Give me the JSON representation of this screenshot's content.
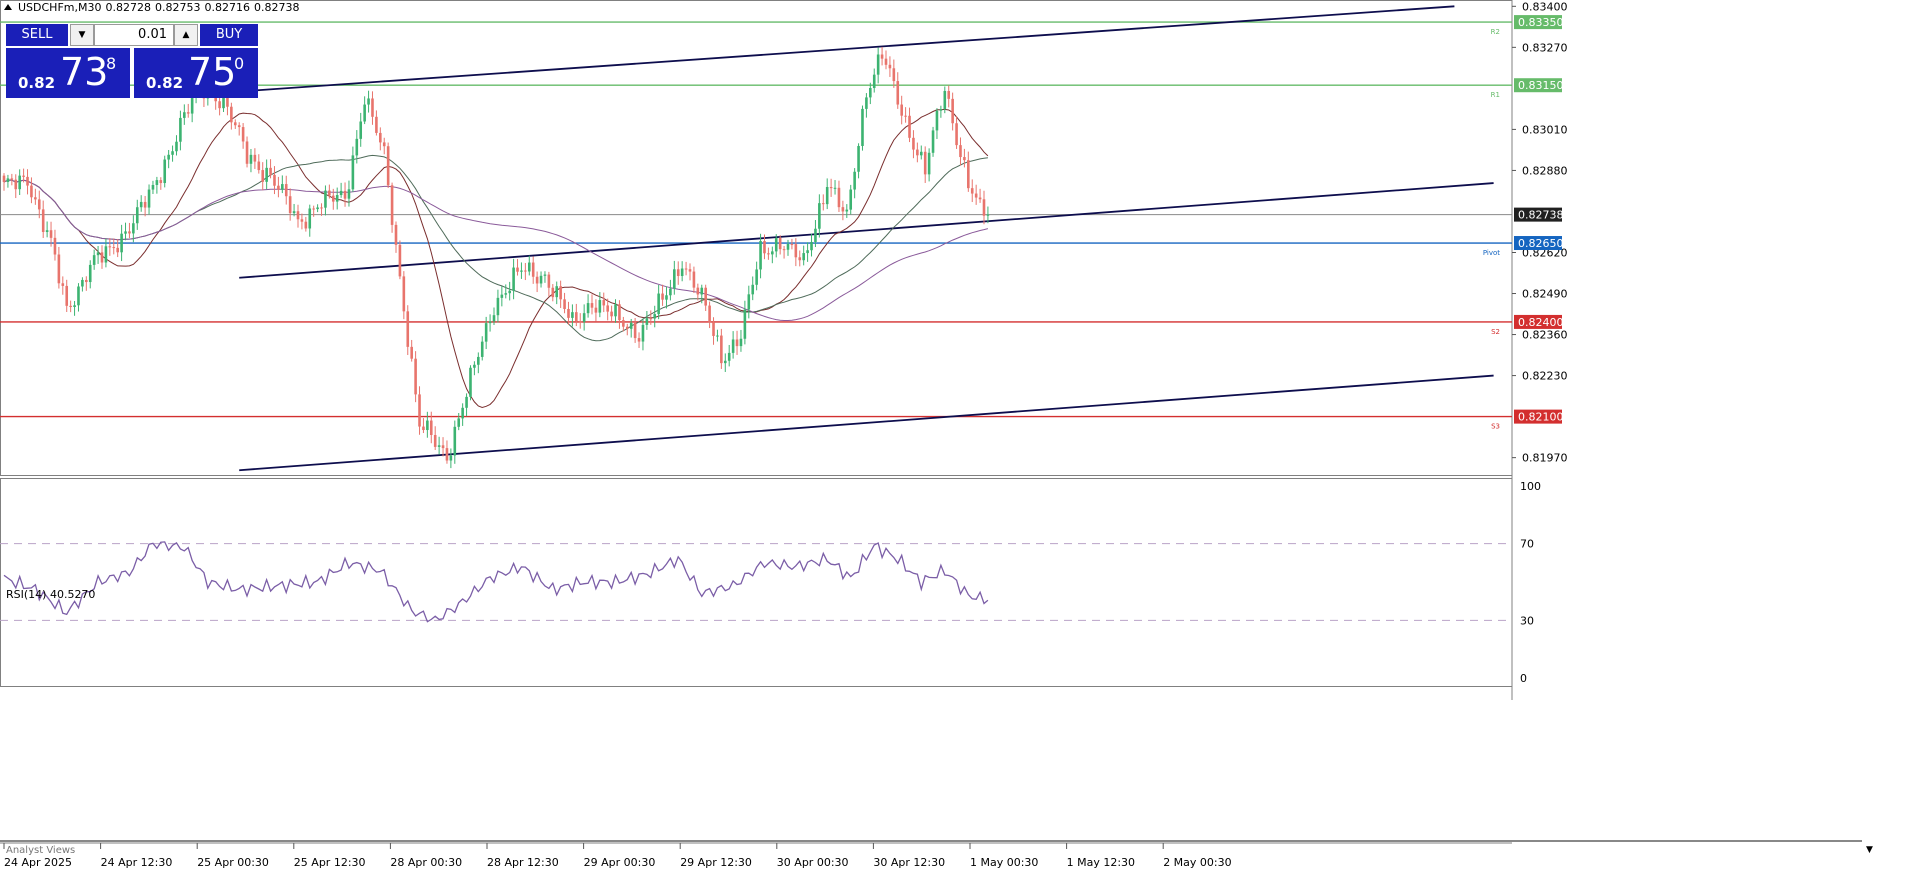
{
  "symbol_header": {
    "symbol": "USDCHFm,M30",
    "open": "0.82728",
    "high": "0.82753",
    "low": "0.82716",
    "close": "0.82738"
  },
  "trade_panel": {
    "sell_label": "SELL",
    "buy_label": "BUY",
    "lot": "0.01",
    "sell_small": "0.82",
    "sell_big": "73",
    "sell_sup": "8",
    "buy_small": "0.82",
    "buy_big": "75",
    "buy_sup": "0"
  },
  "colors": {
    "bull": "#3cb371",
    "bear": "#e8746c",
    "support": "#d32f2f",
    "resistance": "#66bb6a",
    "pivot": "#1565c0",
    "channel": "#0d0d4d",
    "rsi": "#7b5ea7"
  },
  "price_axis": {
    "ticks": [
      "0.83400",
      "0.83270",
      "0.83010",
      "0.82880",
      "0.82620",
      "0.82490",
      "0.82360",
      "0.82230",
      "0.81970"
    ],
    "ylim": [
      0.81915,
      0.8342
    ]
  },
  "levels": [
    {
      "name": "R2",
      "price": 0.8335,
      "label": "0.83350",
      "color": "#66bb6a"
    },
    {
      "name": "R1",
      "price": 0.8315,
      "label": "0.83150",
      "color": "#66bb6a"
    },
    {
      "name": "Pivot",
      "price": 0.8265,
      "label": "0.82650",
      "color": "#1565c0"
    },
    {
      "name": "S2",
      "price": 0.824,
      "label": "0.82400",
      "color": "#d32f2f"
    },
    {
      "name": "S3",
      "price": 0.821,
      "label": "0.82100",
      "color": "#d32f2f"
    }
  ],
  "current_price": {
    "price": 0.82738,
    "label": "0.82738"
  },
  "time_axis": {
    "labels": [
      "24 Apr 2025",
      "24 Apr 12:30",
      "25 Apr 00:30",
      "25 Apr 12:30",
      "28 Apr 00:30",
      "28 Apr 12:30",
      "29 Apr 00:30",
      "29 Apr 12:30",
      "30 Apr 00:30",
      "30 Apr 12:30",
      "1 May 00:30",
      "1 May 12:30",
      "2 May 00:30"
    ]
  },
  "rsi": {
    "title": "RSI(14) 40.5270",
    "ticks": [
      "100",
      "70",
      "30",
      "0"
    ]
  },
  "analyst_label": "Analyst Views",
  "chart_data": {
    "type": "candlestick",
    "timeframe": "M30",
    "symbol": "USDCHFm",
    "close_anchors": [
      [
        0,
        0.8282
      ],
      [
        6,
        0.8286
      ],
      [
        12,
        0.8264
      ],
      [
        16,
        0.8244
      ],
      [
        22,
        0.8258
      ],
      [
        27,
        0.8262
      ],
      [
        32,
        0.8271
      ],
      [
        38,
        0.8281
      ],
      [
        45,
        0.8303
      ],
      [
        50,
        0.8314
      ],
      [
        56,
        0.8311
      ],
      [
        62,
        0.8292
      ],
      [
        68,
        0.8287
      ],
      [
        75,
        0.8271
      ],
      [
        80,
        0.8278
      ],
      [
        87,
        0.8279
      ],
      [
        92,
        0.8312
      ],
      [
        97,
        0.8292
      ],
      [
        103,
        0.8236
      ],
      [
        106,
        0.8207
      ],
      [
        113,
        0.8198
      ],
      [
        119,
        0.8221
      ],
      [
        125,
        0.8246
      ],
      [
        132,
        0.8256
      ],
      [
        138,
        0.8255
      ],
      [
        145,
        0.8239
      ],
      [
        150,
        0.8247
      ],
      [
        156,
        0.8241
      ],
      [
        162,
        0.8237
      ],
      [
        168,
        0.8246
      ],
      [
        173,
        0.826
      ],
      [
        178,
        0.8247
      ],
      [
        183,
        0.8229
      ],
      [
        188,
        0.8236
      ],
      [
        193,
        0.8262
      ],
      [
        198,
        0.8266
      ],
      [
        204,
        0.8258
      ],
      [
        210,
        0.8285
      ],
      [
        215,
        0.8272
      ],
      [
        220,
        0.8314
      ],
      [
        224,
        0.8325
      ],
      [
        229,
        0.8306
      ],
      [
        235,
        0.8289
      ],
      [
        240,
        0.8313
      ],
      [
        246,
        0.8285
      ],
      [
        249,
        0.8275
      ],
      [
        251,
        0.8274
      ]
    ],
    "moving_averages": [
      {
        "name": "MA fast",
        "color": "#7a2e2e"
      },
      {
        "name": "MA mid",
        "color": "#4f6b5a"
      },
      {
        "name": "MA slow",
        "color": "#8a5a9a"
      }
    ],
    "rsi_anchors": [
      [
        0,
        52
      ],
      [
        8,
        46
      ],
      [
        16,
        34
      ],
      [
        24,
        50
      ],
      [
        32,
        55
      ],
      [
        38,
        70
      ],
      [
        46,
        68
      ],
      [
        52,
        50
      ],
      [
        60,
        46
      ],
      [
        70,
        48
      ],
      [
        80,
        50
      ],
      [
        88,
        60
      ],
      [
        96,
        56
      ],
      [
        104,
        35
      ],
      [
        110,
        30
      ],
      [
        116,
        38
      ],
      [
        124,
        52
      ],
      [
        132,
        58
      ],
      [
        140,
        46
      ],
      [
        148,
        50
      ],
      [
        156,
        50
      ],
      [
        164,
        54
      ],
      [
        172,
        62
      ],
      [
        178,
        44
      ],
      [
        186,
        48
      ],
      [
        194,
        60
      ],
      [
        202,
        58
      ],
      [
        210,
        62
      ],
      [
        216,
        52
      ],
      [
        222,
        69
      ],
      [
        228,
        62
      ],
      [
        234,
        50
      ],
      [
        240,
        56
      ],
      [
        246,
        43
      ],
      [
        251,
        40.527
      ]
    ],
    "rsi_ylim": [
      0,
      100
    ],
    "rsi_levels": [
      70,
      30
    ],
    "channel_lines": [
      {
        "name": "upper channel",
        "p1": [
          60,
          0.8313
        ],
        "p2": [
          370,
          0.834
        ]
      },
      {
        "name": "mid channel",
        "p1": [
          60,
          0.8254
        ],
        "p2": [
          380,
          0.8284
        ]
      },
      {
        "name": "lower channel",
        "p1": [
          60,
          0.8193
        ],
        "p2": [
          380,
          0.8223
        ]
      }
    ]
  }
}
